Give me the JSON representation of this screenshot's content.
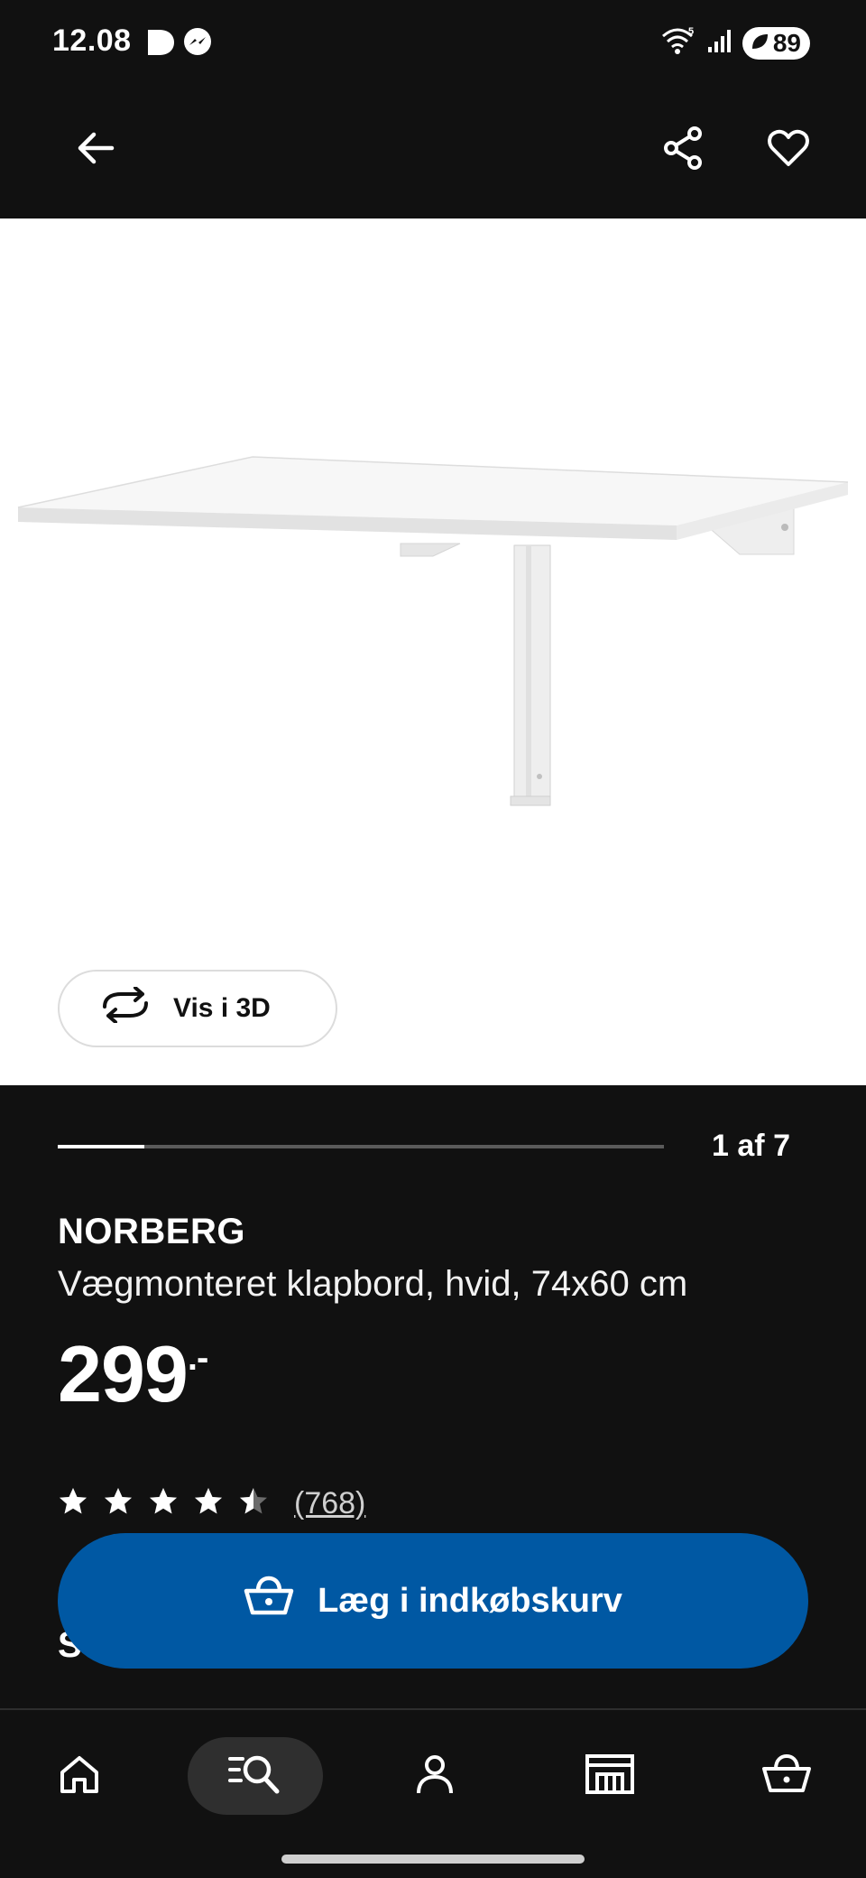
{
  "status_bar": {
    "time": "12.08",
    "battery": "89",
    "signal_label": "5"
  },
  "app_bar": {
    "back_icon": "arrow-left-icon",
    "share_icon": "share-icon",
    "favorite_icon": "heart-icon"
  },
  "gallery": {
    "view_3d_label": "Vis i 3D",
    "counter": "1 af 7",
    "progress_fraction": 0.143
  },
  "product": {
    "name": "NORBERG",
    "description": "Vægmonteret klapbord, hvid, 74x60 cm",
    "price": "299",
    "price_suffix": ".-",
    "rating_value": 4.5,
    "rating_count": "(768)"
  },
  "section_peek": "Se",
  "cart_button": {
    "label": "Læg i indkøbskurv"
  },
  "bottom_nav": {
    "items": [
      "home-icon",
      "search-icon",
      "profile-icon",
      "store-icon",
      "basket-icon"
    ],
    "active": "search-icon"
  },
  "colors": {
    "background": "#111111",
    "accent_blue": "#0058a3",
    "white": "#ffffff"
  }
}
